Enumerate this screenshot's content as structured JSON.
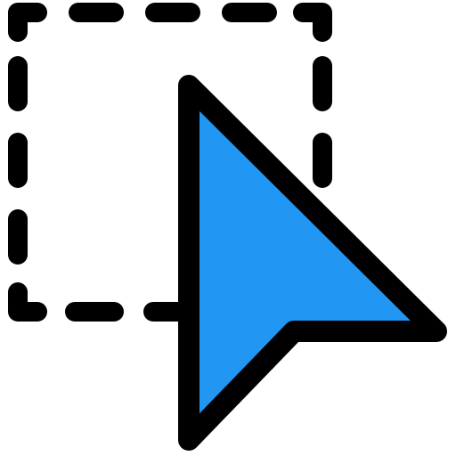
{
  "icon": {
    "name": "selection-cursor-icon",
    "colors": {
      "fill": "#2196F3",
      "stroke": "#000000",
      "background": "#FFFFFF"
    }
  }
}
